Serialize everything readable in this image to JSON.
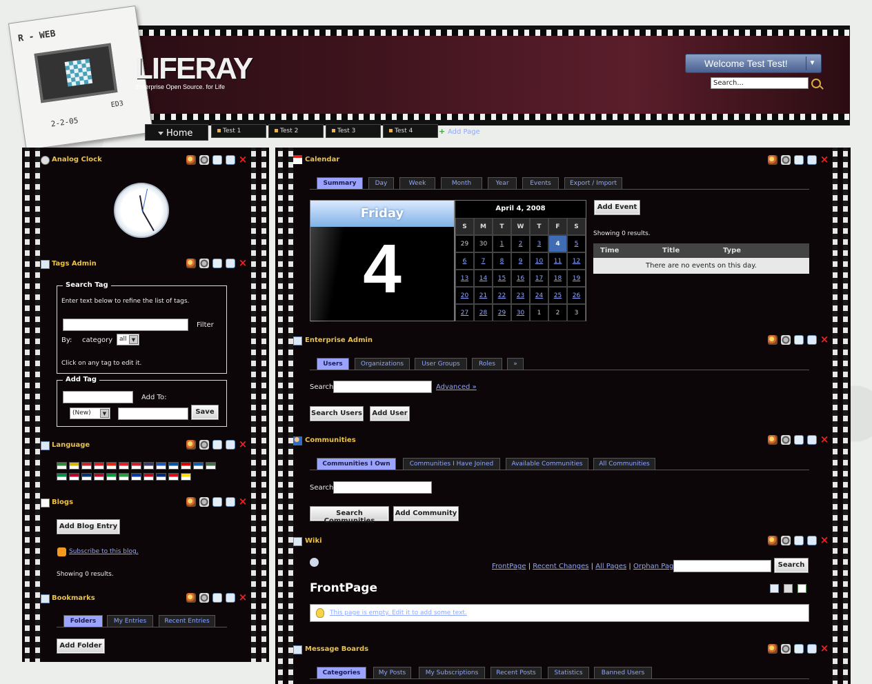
{
  "header": {
    "logo_text": "LIFERAY",
    "tagline": "Enterprise Open Source. for Life",
    "card_top": "R - WEB",
    "card_date": "2-2-05",
    "card_code": "ED3",
    "welcome": "Welcome Test Test!",
    "search_value": "Search..."
  },
  "nav": {
    "home": "Home",
    "tabs": [
      "Test 1",
      "Test 2",
      "Test 3",
      "Test 4"
    ],
    "add_page": "Add Page"
  },
  "clock": {
    "title": "Analog Clock"
  },
  "tags": {
    "title": "Tags Admin",
    "search_legend": "Search Tag",
    "hint": "Enter text below to refine the list of tags.",
    "filter": "Filter",
    "by": "By:",
    "category": "category",
    "all": "all",
    "click_hint": "Click on any tag to edit it.",
    "add_legend": "Add Tag",
    "add_to": "Add To:",
    "new": "(New)",
    "save": "Save"
  },
  "language": {
    "title": "Language",
    "flags_row1": [
      "#2e8b3a",
      "#d7b500",
      "#c4282b",
      "#d91f26",
      "#de2910",
      "#e31e24",
      "#cc1f2e",
      "#3c3b6e",
      "#1c5ab8",
      "#0055a4",
      "#dd0000",
      "#0d5eaf",
      "#436f4d"
    ],
    "flags_row2": [
      "#009246",
      "#bc002d",
      "#003478",
      "#ba0c2f",
      "#009b3a",
      "#239f40",
      "#0039a6",
      "#c60b1e",
      "#002b7f",
      "#e30a17",
      "#ffdd00"
    ]
  },
  "blogs": {
    "title": "Blogs",
    "add": "Add Blog Entry",
    "subscribe": "Subscribe to this blog.",
    "results": "Showing 0 results."
  },
  "bookmarks": {
    "title": "Bookmarks",
    "tabs": [
      "Folders",
      "My Entries",
      "Recent Entries"
    ],
    "add": "Add Folder"
  },
  "calendar": {
    "title": "Calendar",
    "tabs": [
      "Summary",
      "Day",
      "Week",
      "Month",
      "Year",
      "Events",
      "Export / Import"
    ],
    "weekday": "Friday",
    "daynum": "4",
    "month_label": "April 4, 2008",
    "days": [
      "S",
      "M",
      "T",
      "W",
      "T",
      "F",
      "S"
    ],
    "cells": [
      [
        "29",
        "30",
        "1",
        "2",
        "3",
        "4",
        "5"
      ],
      [
        "6",
        "7",
        "8",
        "9",
        "10",
        "11",
        "12"
      ],
      [
        "13",
        "14",
        "15",
        "16",
        "17",
        "18",
        "19"
      ],
      [
        "20",
        "21",
        "22",
        "23",
        "24",
        "25",
        "26"
      ],
      [
        "27",
        "28",
        "29",
        "30",
        "1",
        "2",
        "3"
      ]
    ],
    "add_event": "Add Event",
    "results": "Showing 0 results.",
    "col_time": "Time",
    "col_title": "Title",
    "col_type": "Type",
    "empty": "There are no events on this day."
  },
  "enterprise": {
    "title": "Enterprise Admin",
    "tabs": [
      "Users",
      "Organizations",
      "User Groups",
      "Roles",
      "»"
    ],
    "search": "Search",
    "advanced": "Advanced »",
    "search_btn": "Search Users",
    "add_btn": "Add User"
  },
  "communities": {
    "title": "Communities",
    "tabs": [
      "Communities I Own",
      "Communities I Have Joined",
      "Available Communities",
      "All Communities"
    ],
    "search": "Search",
    "search_btn": "Search Communities",
    "add_btn": "Add Community"
  },
  "wiki": {
    "title": "Wiki",
    "links": [
      "FrontPage",
      "Recent Changes",
      "All Pages",
      "Orphan Pages"
    ],
    "search_btn": "Search",
    "page_title": "FrontPage",
    "empty": "This page is empty. Edit it to add some text."
  },
  "boards": {
    "title": "Message Boards",
    "tabs": [
      "Categories",
      "My Posts",
      "My Subscriptions",
      "Recent Posts",
      "Statistics",
      "Banned Users"
    ]
  }
}
